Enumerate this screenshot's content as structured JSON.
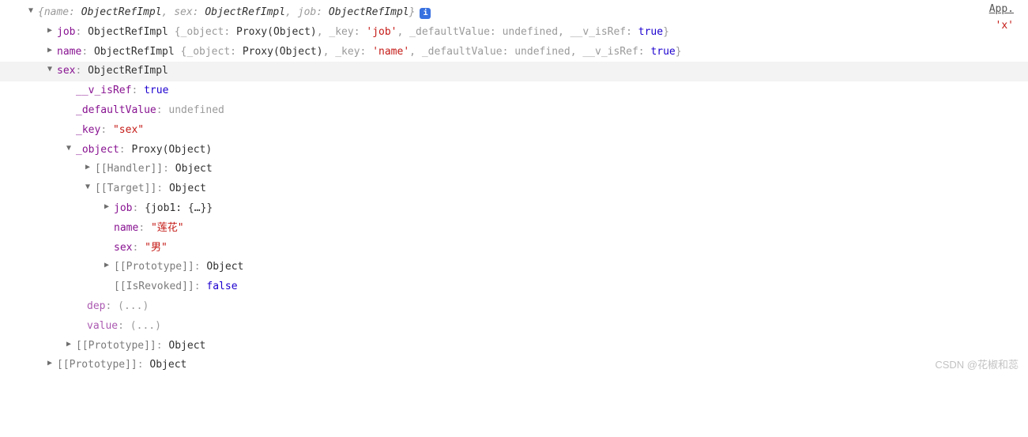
{
  "source_link": "App.",
  "top_x": "'x'",
  "root_summary": {
    "pre": "{name: ",
    "v1": "ObjectRefImpl",
    "mid1": ", sex: ",
    "v2": "ObjectRefImpl",
    "mid2": ", job: ",
    "v3": "ObjectRefImpl",
    "post": "}"
  },
  "info_badge": "i",
  "job_line": {
    "key": "job",
    "class": "ObjectRefImpl ",
    "obj_open": "{_object: ",
    "proxy": "Proxy(Object)",
    "key_lbl": ", _key: ",
    "key_val": "'job'",
    "def_lbl": ", _defaultValue: ",
    "def_val": "undefined",
    "ref_lbl": ", __v_isRef: ",
    "ref_val": "true",
    "close": "}"
  },
  "name_line": {
    "key": "name",
    "class": "ObjectRefImpl ",
    "obj_open": "{_object: ",
    "proxy": "Proxy(Object)",
    "key_lbl": ", _key: ",
    "key_val": "'name'",
    "def_lbl": ", _defaultValue: ",
    "def_val": "undefined",
    "ref_lbl": ", __v_isRef: ",
    "ref_val": "true",
    "close": "}"
  },
  "sex_line": {
    "key": "sex",
    "class": "ObjectRefImpl"
  },
  "sex_props": {
    "isref_k": "__v_isRef",
    "isref_v": "true",
    "def_k": "_defaultValue",
    "def_v": "undefined",
    "key_k": "_key",
    "key_v": "\"sex\"",
    "obj_k": "_object",
    "obj_v": "Proxy(Object)",
    "handler_k": "[[Handler]]",
    "handler_v": "Object",
    "target_k": "[[Target]]",
    "target_v": "Object",
    "t_job_k": "job",
    "t_job_v": "{job1: {…}}",
    "t_name_k": "name",
    "t_name_v": "\"莲花\"",
    "t_sex_k": "sex",
    "t_sex_v": "\"男\"",
    "proto_k": "[[Prototype]]",
    "proto_v": "Object",
    "isrev_k": "[[IsRevoked]]",
    "isrev_v": "false",
    "dep_k": "dep",
    "dep_v": "(...)",
    "value_k": "value",
    "value_v": "(...)"
  },
  "watermark": "CSDN @花椒和蕊"
}
